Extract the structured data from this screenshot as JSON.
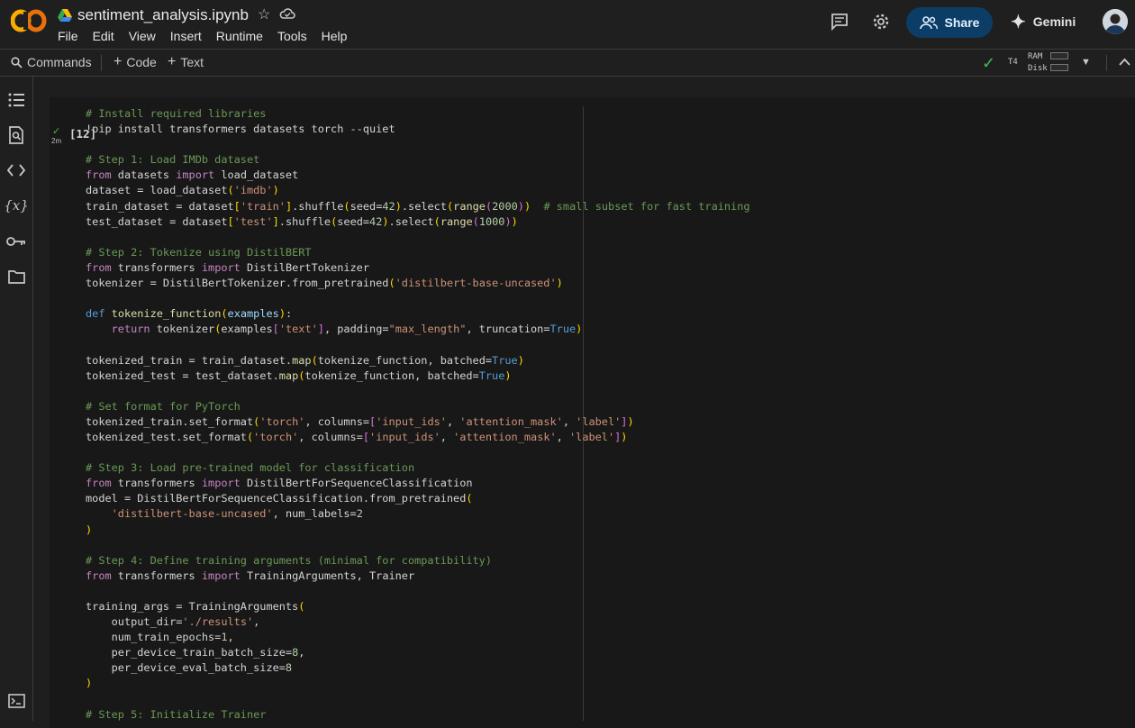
{
  "header": {
    "notebook_title": "sentiment_analysis.ipynb",
    "menu": [
      "File",
      "Edit",
      "View",
      "Insert",
      "Runtime",
      "Tools",
      "Help"
    ],
    "share_label": "Share",
    "gemini_label": "Gemini"
  },
  "toolbar": {
    "commands_label": "Commands",
    "code_label": "Code",
    "text_label": "Text",
    "runtime_type": "T4",
    "ram_label": "RAM",
    "disk_label": "Disk"
  },
  "cell": {
    "execution_count": "[12]",
    "run_time": "2m",
    "code_lines": [
      [
        [
          "c-cm",
          "# Install required libraries"
        ]
      ],
      [
        [
          "",
          "!pip install transformers datasets torch --quiet"
        ]
      ],
      [
        [
          "",
          ""
        ]
      ],
      [
        [
          "c-cm",
          "# Step 1: Load IMDb dataset"
        ]
      ],
      [
        [
          "c-kw",
          "from"
        ],
        [
          "",
          " datasets "
        ],
        [
          "c-kw",
          "import"
        ],
        [
          "",
          " load_dataset"
        ]
      ],
      [
        [
          "",
          "dataset = load_dataset"
        ],
        [
          "c-br",
          "("
        ],
        [
          "c-st",
          "'imdb'"
        ],
        [
          "c-br",
          ")"
        ]
      ],
      [
        [
          "",
          "train_dataset = dataset"
        ],
        [
          "c-br",
          "["
        ],
        [
          "c-st",
          "'train'"
        ],
        [
          "c-br",
          "]"
        ],
        [
          "",
          ".shuffle"
        ],
        [
          "c-br",
          "("
        ],
        [
          "",
          "seed="
        ],
        [
          "c-nm",
          "42"
        ],
        [
          "c-br",
          ")"
        ],
        [
          "",
          ".select"
        ],
        [
          "c-br",
          "("
        ],
        [
          "c-fn",
          "range"
        ],
        [
          "c-bp",
          "("
        ],
        [
          "c-nm",
          "2000"
        ],
        [
          "c-bp",
          ")"
        ],
        [
          "c-br",
          ")"
        ],
        [
          "",
          "  "
        ],
        [
          "c-cm",
          "# small subset for fast training"
        ]
      ],
      [
        [
          "",
          "test_dataset = dataset"
        ],
        [
          "c-br",
          "["
        ],
        [
          "c-st",
          "'test'"
        ],
        [
          "c-br",
          "]"
        ],
        [
          "",
          ".shuffle"
        ],
        [
          "c-br",
          "("
        ],
        [
          "",
          "seed="
        ],
        [
          "c-nm",
          "42"
        ],
        [
          "c-br",
          ")"
        ],
        [
          "",
          ".select"
        ],
        [
          "c-br",
          "("
        ],
        [
          "c-fn",
          "range"
        ],
        [
          "c-bp",
          "("
        ],
        [
          "c-nm",
          "1000"
        ],
        [
          "c-bp",
          ")"
        ],
        [
          "c-br",
          ")"
        ]
      ],
      [
        [
          "",
          ""
        ]
      ],
      [
        [
          "c-cm",
          "# Step 2: Tokenize using DistilBERT"
        ]
      ],
      [
        [
          "c-kw",
          "from"
        ],
        [
          "",
          " transformers "
        ],
        [
          "c-kw",
          "import"
        ],
        [
          "",
          " DistilBertTokenizer"
        ]
      ],
      [
        [
          "",
          "tokenizer = DistilBertTokenizer.from_pretrained"
        ],
        [
          "c-br",
          "("
        ],
        [
          "c-st",
          "'distilbert-base-uncased'"
        ],
        [
          "c-br",
          ")"
        ]
      ],
      [
        [
          "",
          ""
        ]
      ],
      [
        [
          "c-bi",
          "def"
        ],
        [
          "",
          " "
        ],
        [
          "c-fn",
          "tokenize_function"
        ],
        [
          "c-br",
          "("
        ],
        [
          "c-pm",
          "examples"
        ],
        [
          "c-br",
          ")"
        ],
        [
          "",
          ":"
        ]
      ],
      [
        [
          "",
          "    "
        ],
        [
          "c-kw",
          "return"
        ],
        [
          "",
          " tokenizer"
        ],
        [
          "c-br",
          "("
        ],
        [
          "",
          "examples"
        ],
        [
          "c-bp",
          "["
        ],
        [
          "c-st",
          "'text'"
        ],
        [
          "c-bp",
          "]"
        ],
        [
          "",
          ", padding="
        ],
        [
          "c-st",
          "\"max_length\""
        ],
        [
          "",
          ", truncation="
        ],
        [
          "c-bi",
          "True"
        ],
        [
          "c-br",
          ")"
        ]
      ],
      [
        [
          "",
          ""
        ]
      ],
      [
        [
          "",
          "tokenized_train = train_dataset."
        ],
        [
          "c-fn",
          "map"
        ],
        [
          "c-br",
          "("
        ],
        [
          "",
          "tokenize_function, batched="
        ],
        [
          "c-bi",
          "True"
        ],
        [
          "c-br",
          ")"
        ]
      ],
      [
        [
          "",
          "tokenized_test = test_dataset."
        ],
        [
          "c-fn",
          "map"
        ],
        [
          "c-br",
          "("
        ],
        [
          "",
          "tokenize_function, batched="
        ],
        [
          "c-bi",
          "True"
        ],
        [
          "c-br",
          ")"
        ]
      ],
      [
        [
          "",
          ""
        ]
      ],
      [
        [
          "c-cm",
          "# Set format for PyTorch"
        ]
      ],
      [
        [
          "",
          "tokenized_train.set_format"
        ],
        [
          "c-br",
          "("
        ],
        [
          "c-st",
          "'torch'"
        ],
        [
          "",
          ", columns="
        ],
        [
          "c-bp",
          "["
        ],
        [
          "c-st",
          "'input_ids'"
        ],
        [
          "",
          ", "
        ],
        [
          "c-st",
          "'attention_mask'"
        ],
        [
          "",
          ", "
        ],
        [
          "c-st",
          "'label'"
        ],
        [
          "c-bp",
          "]"
        ],
        [
          "c-br",
          ")"
        ]
      ],
      [
        [
          "",
          "tokenized_test.set_format"
        ],
        [
          "c-br",
          "("
        ],
        [
          "c-st",
          "'torch'"
        ],
        [
          "",
          ", columns="
        ],
        [
          "c-bp",
          "["
        ],
        [
          "c-st",
          "'input_ids'"
        ],
        [
          "",
          ", "
        ],
        [
          "c-st",
          "'attention_mask'"
        ],
        [
          "",
          ", "
        ],
        [
          "c-st",
          "'label'"
        ],
        [
          "c-bp",
          "]"
        ],
        [
          "c-br",
          ")"
        ]
      ],
      [
        [
          "",
          ""
        ]
      ],
      [
        [
          "c-cm",
          "# Step 3: Load pre-trained model for classification"
        ]
      ],
      [
        [
          "c-kw",
          "from"
        ],
        [
          "",
          " transformers "
        ],
        [
          "c-kw",
          "import"
        ],
        [
          "",
          " DistilBertForSequenceClassification"
        ]
      ],
      [
        [
          "",
          "model = DistilBertForSequenceClassification.from_pretrained"
        ],
        [
          "c-br",
          "("
        ]
      ],
      [
        [
          "",
          "    "
        ],
        [
          "c-st",
          "'distilbert-base-uncased'"
        ],
        [
          "",
          ", num_labels="
        ],
        [
          "c-nm",
          "2"
        ]
      ],
      [
        [
          "c-br",
          ")"
        ]
      ],
      [
        [
          "",
          ""
        ]
      ],
      [
        [
          "c-cm",
          "# Step 4: Define training arguments (minimal for compatibility)"
        ]
      ],
      [
        [
          "c-kw",
          "from"
        ],
        [
          "",
          " transformers "
        ],
        [
          "c-kw",
          "import"
        ],
        [
          "",
          " TrainingArguments, Trainer"
        ]
      ],
      [
        [
          "",
          ""
        ]
      ],
      [
        [
          "",
          "training_args = TrainingArguments"
        ],
        [
          "c-br",
          "("
        ]
      ],
      [
        [
          "",
          "    output_dir="
        ],
        [
          "c-st",
          "'./results'"
        ],
        [
          "",
          ","
        ]
      ],
      [
        [
          "",
          "    num_train_epochs="
        ],
        [
          "c-nm",
          "1"
        ],
        [
          "",
          ","
        ]
      ],
      [
        [
          "",
          "    per_device_train_batch_size="
        ],
        [
          "c-nm",
          "8"
        ],
        [
          "",
          ","
        ]
      ],
      [
        [
          "",
          "    per_device_eval_batch_size="
        ],
        [
          "c-nm",
          "8"
        ]
      ],
      [
        [
          "c-br",
          ")"
        ]
      ],
      [
        [
          "",
          ""
        ]
      ],
      [
        [
          "c-cm",
          "# Step 5: Initialize Trainer"
        ]
      ]
    ]
  },
  "icons": {
    "sidebar": [
      "toc-icon",
      "find-icon",
      "code-snippets-icon",
      "variables-icon",
      "secrets-key-icon",
      "files-folder-icon",
      "terminal-icon"
    ]
  },
  "colors": {
    "accent_share": "#0b3d66",
    "status_ok": "#3fba50",
    "logo_orange": "#f9ab00"
  }
}
